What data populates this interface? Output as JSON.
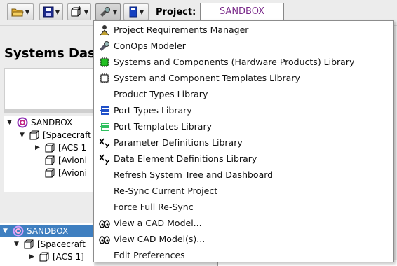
{
  "toolbar": {
    "project_label": "Project:",
    "project_value": "SANDBOX",
    "buttons": [
      "open-folder-icon",
      "save-disk-icon",
      "new-item-icon",
      "tools-icon",
      "book-icon"
    ]
  },
  "dashboard": {
    "title": "Systems Das"
  },
  "tree_upper": [
    {
      "label": "SANDBOX"
    },
    {
      "label": "[Spacecraft"
    },
    {
      "label": "[ACS 1"
    },
    {
      "label": "[Avioni"
    },
    {
      "label": "[Avioni"
    }
  ],
  "tree_lower": [
    {
      "label": "SANDBOX"
    },
    {
      "label": "[Spacecraft"
    },
    {
      "label": "[ACS 1]"
    }
  ],
  "menu": {
    "items": [
      {
        "label": "Project Requirements Manager",
        "icon": "requirements-icon"
      },
      {
        "label": "ConOps Modeler",
        "icon": "conops-icon"
      },
      {
        "label": "Systems and Components (Hardware Products) Library",
        "icon": "hardware-green-icon"
      },
      {
        "label": "System and Component Templates Library",
        "icon": "template-outline-icon"
      },
      {
        "label": "Product Types Library",
        "icon": ""
      },
      {
        "label": "Port Types Library",
        "icon": "port-types-icon"
      },
      {
        "label": "Port Templates Library",
        "icon": "port-templates-icon"
      },
      {
        "label": "Parameter Definitions Library",
        "icon": "xy-parameter-icon"
      },
      {
        "label": "Data Element Definitions Library",
        "icon": "xy-data-icon"
      },
      {
        "label": "Refresh System Tree and Dashboard",
        "icon": ""
      },
      {
        "label": "Re-Sync Current Project",
        "icon": ""
      },
      {
        "label": "Force Full Re-Sync",
        "icon": ""
      },
      {
        "label": "View a CAD Model...",
        "icon": "cad-eyes-icon"
      },
      {
        "label": "View CAD Model(s)...",
        "icon": "cad-eyes-icon"
      },
      {
        "label": "Edit Preferences",
        "icon": ""
      }
    ]
  },
  "colors": {
    "project_text": "#7a2a8a",
    "selection": "#3f7fc0",
    "hardware_green": "#22c022",
    "port_blue": "#2050c8",
    "port_green": "#30c060"
  }
}
